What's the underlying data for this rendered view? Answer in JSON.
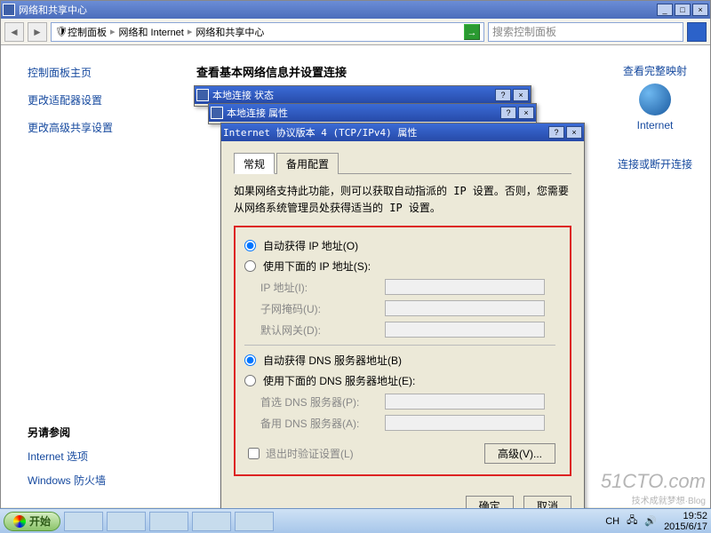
{
  "explorer": {
    "title": "网络和共享中心",
    "breadcrumb": [
      "控制面板",
      "网络和 Internet",
      "网络和共享中心"
    ],
    "search_placeholder": "搜索控制面板"
  },
  "sidebar": {
    "home": "控制面板主页",
    "links": [
      "更改适配器设置",
      "更改高级共享设置"
    ]
  },
  "main": {
    "heading": "查看基本网络信息并设置连接",
    "full_map": "查看完整映射",
    "internet_label": "Internet",
    "connect_disconnect": "连接或断开连接"
  },
  "also_see": {
    "title": "另请参阅",
    "items": [
      "Internet 选项",
      "Windows 防火墙"
    ]
  },
  "dlg_status": {
    "title": "本地连接 状态"
  },
  "dlg_props": {
    "title": "本地连接 属性"
  },
  "dlg_tcp": {
    "title": "Internet 协议版本 4 (TCP/IPv4) 属性",
    "tabs": [
      "常规",
      "备用配置"
    ],
    "description": "如果网络支持此功能，则可以获取自动指派的 IP 设置。否则，您需要从网络系统管理员处获得适当的 IP 设置。",
    "radio_auto_ip": "自动获得 IP 地址(O)",
    "radio_manual_ip": "使用下面的 IP 地址(S):",
    "ip_label": "IP 地址(I):",
    "mask_label": "子网掩码(U):",
    "gateway_label": "默认网关(D):",
    "radio_auto_dns": "自动获得 DNS 服务器地址(B)",
    "radio_manual_dns": "使用下面的 DNS 服务器地址(E):",
    "pref_dns_label": "首选 DNS 服务器(P):",
    "alt_dns_label": "备用 DNS 服务器(A):",
    "validate_exit": "退出时验证设置(L)",
    "advanced_btn": "高级(V)...",
    "ok": "确定",
    "cancel": "取消"
  },
  "taskbar": {
    "start": "开始",
    "lang": "CH",
    "time": "19:52",
    "date": "2015/6/17"
  },
  "watermark": {
    "main": "51CTO.com",
    "sub": "技术成就梦想·Blog"
  }
}
